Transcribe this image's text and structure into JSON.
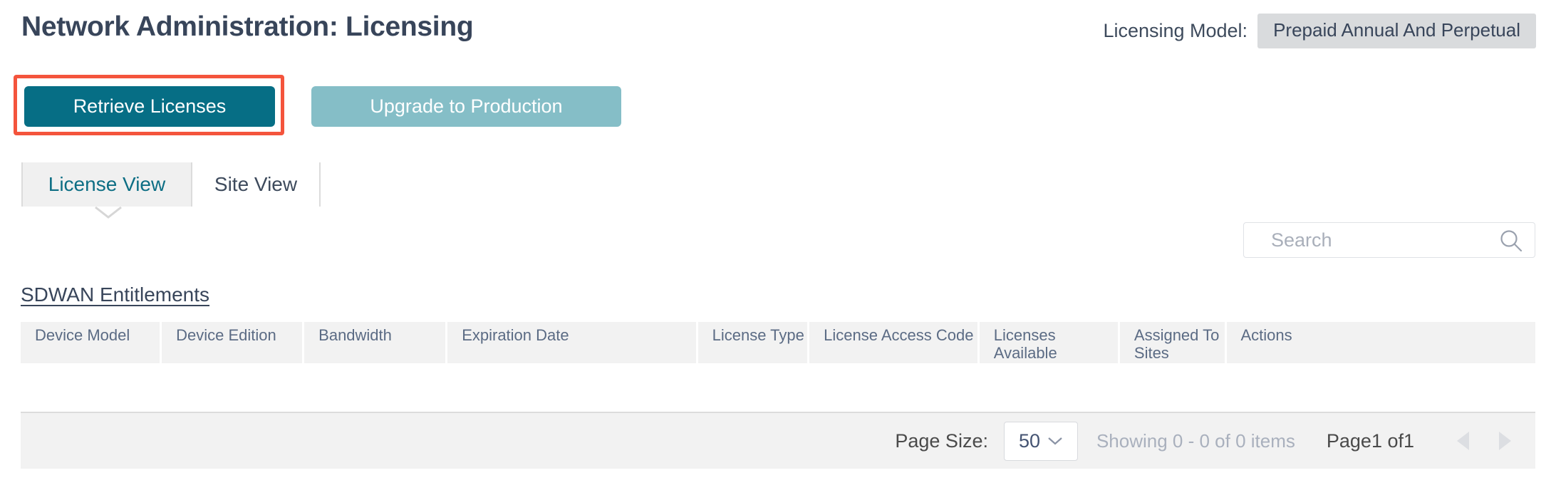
{
  "header": {
    "title": "Network Administration: Licensing",
    "licensing_model_label": "Licensing Model:",
    "licensing_model_value": "Prepaid Annual And Perpetual"
  },
  "actions": {
    "retrieve_licenses_label": "Retrieve Licenses",
    "upgrade_to_production_label": "Upgrade to Production",
    "highlight_color": "#f4543c",
    "primary_color": "#066e85",
    "disabled_color": "#85bec7"
  },
  "tabs": [
    {
      "label": "License View",
      "active": true
    },
    {
      "label": "Site View",
      "active": false
    }
  ],
  "search": {
    "placeholder": "Search",
    "value": "",
    "icon": "search-icon"
  },
  "section": {
    "title": "SDWAN Entitlements"
  },
  "table": {
    "columns": [
      "Device Model",
      "Device Edition",
      "Bandwidth",
      "Expiration Date",
      "License Type",
      "License Access Code",
      "Licenses Available",
      "Assigned To Sites",
      "Actions"
    ],
    "rows": []
  },
  "footer": {
    "page_size_label": "Page Size:",
    "page_size_value": "50",
    "page_size_chevron": "chevron-down-icon",
    "showing_text": "Showing 0 - 0 of 0 items",
    "page_indicator": "Page1 of1",
    "prev_icon": "triangle-left-icon",
    "next_icon": "triangle-right-icon"
  }
}
